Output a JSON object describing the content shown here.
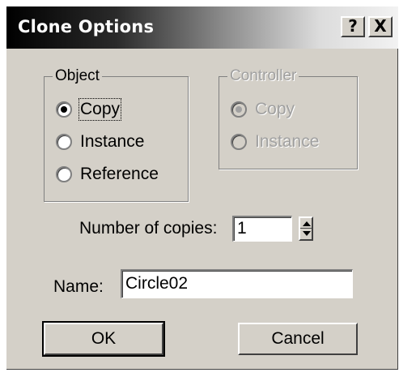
{
  "window": {
    "title": "Clone Options",
    "help_label": "?",
    "close_label": "X"
  },
  "object_group": {
    "legend": "Object",
    "options": [
      {
        "label": "Copy",
        "selected": true
      },
      {
        "label": "Instance",
        "selected": false
      },
      {
        "label": "Reference",
        "selected": false
      }
    ]
  },
  "controller_group": {
    "legend": "Controller",
    "enabled": false,
    "options": [
      {
        "label": "Copy",
        "selected": true
      },
      {
        "label": "Instance",
        "selected": false
      }
    ]
  },
  "copies": {
    "label": "Number of copies:",
    "value": "1"
  },
  "name": {
    "label": "Name:",
    "value": "Circle02"
  },
  "buttons": {
    "ok": "OK",
    "cancel": "Cancel"
  }
}
